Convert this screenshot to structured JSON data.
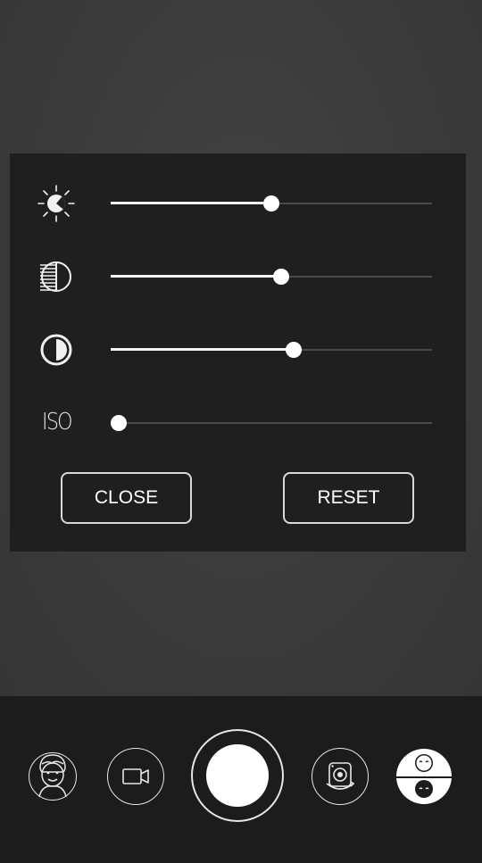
{
  "adjust_panel": {
    "sliders": [
      {
        "name": "brightness",
        "icon": "brightness-icon",
        "value": 0.5
      },
      {
        "name": "exposure",
        "icon": "exposure-icon",
        "value": 0.53
      },
      {
        "name": "contrast",
        "icon": "contrast-icon",
        "value": 0.57
      },
      {
        "name": "iso",
        "icon_label": "ISO",
        "value": 0.0
      }
    ],
    "close_label": "CLOSE",
    "reset_label": "RESET"
  },
  "bottom_bar": {
    "buttons": [
      {
        "name": "face-filter",
        "icon": "face-avatar-icon"
      },
      {
        "name": "video-mode",
        "icon": "video-camera-icon"
      },
      {
        "name": "shutter",
        "icon": "shutter-button"
      },
      {
        "name": "switch-camera",
        "icon": "camera-switch-icon"
      },
      {
        "name": "beauty-mode",
        "icon": "face-swap-icon"
      }
    ]
  },
  "colors": {
    "panel_bg": "#1f1f1f",
    "slider_fill": "#f4f4f4",
    "slider_track": "#4a4a4a",
    "bottom_bar_bg": "#1c1c1c"
  }
}
